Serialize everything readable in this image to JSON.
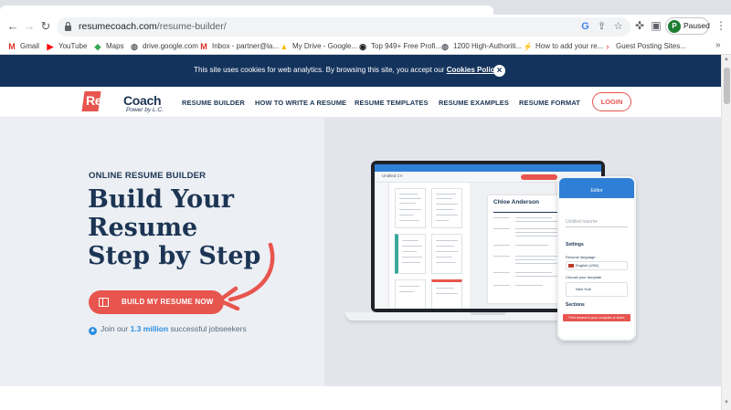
{
  "browser": {
    "url_host": "resumecoach.com",
    "url_path": "/resume-builder/",
    "profile_initial": "P",
    "profile_status": "Paused",
    "bookmarks": [
      {
        "label": "Gmail",
        "icon": "gmail-icon",
        "glyph": "M",
        "color": "#d93025"
      },
      {
        "label": "YouTube",
        "icon": "youtube-icon",
        "glyph": "▶",
        "color": "#ff0000"
      },
      {
        "label": "Maps",
        "icon": "maps-icon",
        "glyph": "◆",
        "color": "#34a853"
      },
      {
        "label": "drive.google.com",
        "icon": "globe-icon",
        "glyph": "◍",
        "color": "#5f6368"
      },
      {
        "label": "Inbox - partner@la...",
        "icon": "gmail-icon",
        "glyph": "M",
        "color": "#d93025"
      },
      {
        "label": "My Drive - Google...",
        "icon": "drive-icon",
        "glyph": "▲",
        "color": "#fbbc04"
      },
      {
        "label": "Top 949+ Free Profi...",
        "icon": "site-icon",
        "glyph": "◉",
        "color": "#202124"
      },
      {
        "label": "1200 High-Authoriti...",
        "icon": "globe-icon",
        "glyph": "◍",
        "color": "#5f6368"
      },
      {
        "label": "How to add your re...",
        "icon": "bolt-icon",
        "glyph": "⚡",
        "color": "#34a853"
      },
      {
        "label": "Guest Posting Sites...",
        "icon": "arrow-icon",
        "glyph": "›",
        "color": "#e8554e"
      }
    ],
    "bookmarks_more": "»"
  },
  "cookie": {
    "text": "This site uses cookies for web analytics. By browsing this site, you accept our ",
    "policy_link": "Cookies Policy",
    "period": "."
  },
  "nav": {
    "logo_part1": "Resume",
    "logo_part2": "Coach",
    "logo_tagline": "Power by L.C.",
    "links": [
      "RESUME BUILDER",
      "HOW TO WRITE A RESUME",
      "RESUME TEMPLATES",
      "RESUME EXAMPLES",
      "RESUME FORMAT"
    ],
    "login": "LOGIN"
  },
  "hero": {
    "eyebrow": "ONLINE RESUME BUILDER",
    "headline": [
      "Build Your",
      "Resume",
      "Step by Step"
    ],
    "cta": "BUILD MY RESUME NOW",
    "joined_prefix": "Join our ",
    "joined_count": "1.3 million",
    "joined_suffix": " successful jobseekers"
  },
  "mockup": {
    "laptop_doc_title": "Untitled CV",
    "laptop_doc_name": "Chloe Anderson",
    "phone_title": "Editor",
    "phone_placeholder": "Untitled resume",
    "phone_settings": "Settings",
    "phone_language_label": "Resume language",
    "phone_language": "English (USA)",
    "phone_template_label": "Choose your template",
    "phone_template": "New York",
    "phone_sections": "Sections",
    "phone_button": "Print resume to your computer or share"
  },
  "colors": {
    "brand_navy": "#1c3554",
    "brand_coral": "#e8554e",
    "cookie_bg": "#14335c",
    "accent_blue": "#2f8fe0"
  }
}
